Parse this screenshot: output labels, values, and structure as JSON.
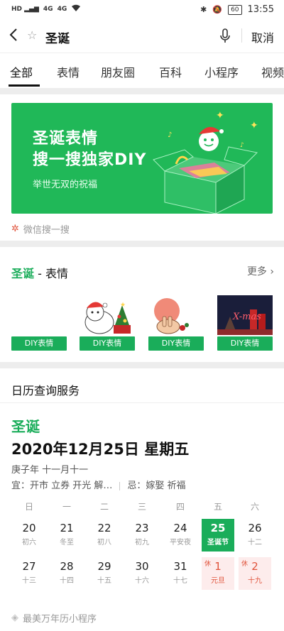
{
  "status": {
    "time": "13:55",
    "battery": "60",
    "net1": "4G",
    "net2": "4G"
  },
  "search": {
    "query": "圣诞",
    "cancel": "取消"
  },
  "tabs": [
    "全部",
    "表情",
    "朋友圈",
    "百科",
    "小程序",
    "视频"
  ],
  "banner": {
    "title1": "圣诞表情",
    "title2": "搜一搜独家DIY",
    "subtitle": "举世无双的祝福",
    "sponsor": "微信搜一搜"
  },
  "stickers": {
    "title_highlight": "圣诞",
    "title_rest": " - 表情",
    "more": "更多",
    "items": [
      {
        "label": "DIY表情"
      },
      {
        "label": "DIY表情"
      },
      {
        "label": "DIY表情"
      },
      {
        "label": "DIY表情",
        "overlay": "X-mas"
      }
    ]
  },
  "calendar": {
    "header": "日历查询服务",
    "festival": "圣诞",
    "date": "2020年12月25日 星期五",
    "lunar": "庚子年 十一月十一",
    "yi": "宜：开市 立券 开光 解…",
    "ji": "忌：嫁娶 祈福",
    "weekdays": [
      "日",
      "一",
      "二",
      "三",
      "四",
      "五",
      "六"
    ],
    "week1": [
      {
        "n": "20",
        "s": "初六"
      },
      {
        "n": "21",
        "s": "冬至"
      },
      {
        "n": "22",
        "s": "初八"
      },
      {
        "n": "23",
        "s": "初九"
      },
      {
        "n": "24",
        "s": "平安夜"
      },
      {
        "n": "25",
        "s": "圣诞节"
      },
      {
        "n": "26",
        "s": "十二"
      }
    ],
    "week2": [
      {
        "n": "27",
        "s": "十三"
      },
      {
        "n": "28",
        "s": "十四"
      },
      {
        "n": "29",
        "s": "十五"
      },
      {
        "n": "30",
        "s": "十六"
      },
      {
        "n": "31",
        "s": "十七"
      },
      {
        "n": "1",
        "s": "元旦",
        "rest": "休"
      },
      {
        "n": "2",
        "s": "十九",
        "rest": "休"
      }
    ],
    "footer": "最美万年历小程序"
  },
  "colors": {
    "accent": "#1aad5a",
    "banner": "#20b858",
    "holiday": "#e0533b"
  }
}
